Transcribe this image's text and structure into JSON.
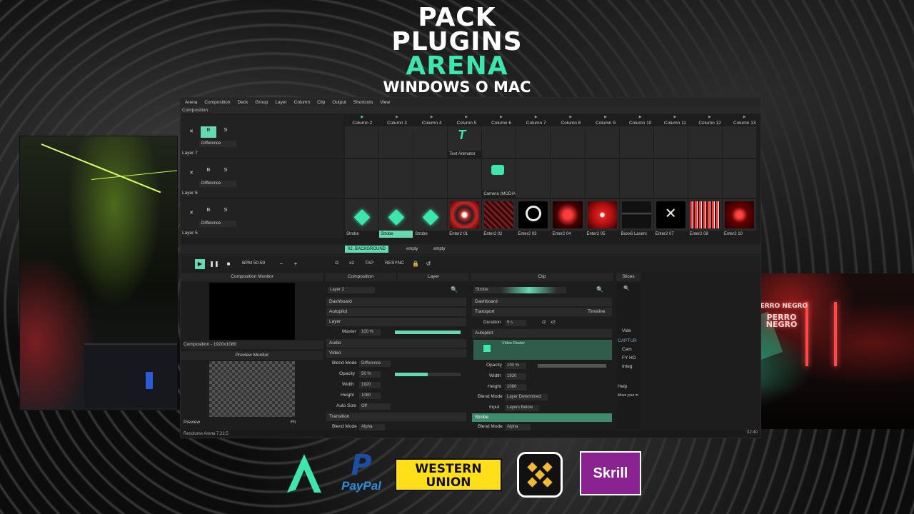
{
  "headline": {
    "line1": "PACK",
    "line2": "PLUGINS",
    "line3": "ARENA",
    "line4": "WINDOWS O MAC"
  },
  "app": {
    "menu": [
      "Arena",
      "Composition",
      "Deck",
      "Group",
      "Layer",
      "Column",
      "Clip",
      "Output",
      "Shortcuts",
      "View"
    ],
    "composition_label": "Composition",
    "columns": [
      "Column 2",
      "Column 3",
      "Column 4",
      "Column 5",
      "Column 6",
      "Column 7",
      "Column 8",
      "Column 9",
      "Column 10",
      "Column 11",
      "Column 12",
      "Column 13"
    ],
    "layers": [
      {
        "name": "Layer 7",
        "blend": "Difference",
        "clips": [
          "",
          "",
          "",
          "Text Animator",
          "",
          "",
          "",
          "",
          "",
          "",
          "",
          ""
        ]
      },
      {
        "name": "Layer 6",
        "blend": "Difference",
        "clips": [
          "",
          "",
          "",
          "",
          "Camera (MODIA 8...",
          "",
          "",
          "",
          "",
          "",
          "",
          ""
        ]
      },
      {
        "name": "Layer 5",
        "blend": "Difference",
        "clips": [
          "Strobe",
          "Strobe",
          "Strobe",
          "Enter2 01",
          "Enter2 02",
          "Enter2 03",
          "Enter2 04",
          "Enter2 05",
          "Boxx6 Lasers",
          "Enter2 07",
          "Enter2 08",
          "Enter2 10"
        ]
      }
    ],
    "deck_tabs": [
      "02. BACKGROUND",
      "empty",
      "empty"
    ],
    "transport": {
      "bpm": "BPM  50.59",
      "tap": "TAP",
      "resync": "RESYNC",
      "half": "/2",
      "double": "x2"
    },
    "panels": {
      "composition_monitor": "Composition Monitor",
      "composition_info": "Composition - 1920x1080",
      "preview_monitor": "Preview Monitor",
      "preview_label": "Preview",
      "preview_fit": "Fit",
      "composition_tab": "Composition",
      "layer_tab": "Layer",
      "clip_tab": "Clip",
      "slices_tab": "Slices"
    },
    "monitor_text": {
      "line1": "PERRO",
      "line2": "NEGRO"
    },
    "layer_panel": {
      "name": "Layer 2",
      "sections": [
        "Dashboard",
        "Autopilot",
        "Layer",
        "Audio",
        "Video",
        "Transition"
      ],
      "master_label": "Master",
      "master_value": "100 %",
      "blend_label": "Blend Mode",
      "blend_value": "Difference",
      "opacity_label": "Opacity",
      "opacity_value": "50 %",
      "width_label": "Width",
      "width_value": "1920",
      "height_label": "Height",
      "height_value": "1080",
      "autosize_label": "Auto Size",
      "autosize_value": "Off",
      "trans_blend_label": "Blend Mode",
      "trans_blend_value": "Alpha"
    },
    "clip_panel": {
      "name": "Strobe",
      "sections": [
        "Dashboard",
        "Transport",
        "Autopilot"
      ],
      "transport_mode": "Timeline",
      "duration_label": "Duration",
      "duration_value": "5 s",
      "half": "/2",
      "double": "x2",
      "effect": "Video Router",
      "opacity_label": "Opacity",
      "opacity_value": "100 %",
      "width_label": "Width",
      "width_value": "1920",
      "height_label": "Height",
      "height_value": "1080",
      "blend_label": "Blend Mode",
      "blend_value": "Layer Determined",
      "input_label": "Input",
      "input_value": "Layers Below",
      "strobe_section": "Strobe",
      "strobe_blend_label": "Blend Mode",
      "strobe_blend_value": "Alpha"
    },
    "slices_panel": {
      "items": [
        "Vide",
        "CAPTUR",
        "Cam",
        "FY HD",
        "Integ",
        "Help",
        "Move your m"
      ]
    },
    "status": {
      "version": "Resolume Arena 7.22.5",
      "time": "02:40"
    }
  },
  "camera_sign": {
    "line1": "PERRO NEGRO",
    "line2": "PERRO",
    "line3": "NEGRO"
  },
  "payments": {
    "paypal_text": "PayPal",
    "western_union_line1": "WESTERN",
    "western_union_line2": "UNION",
    "skrill_text": "Skrill"
  },
  "colors": {
    "accent": "#3ee6ad",
    "selected": "#66d9b0",
    "wu_yellow": "#ffde1a",
    "skrill_purple": "#8a2291"
  }
}
